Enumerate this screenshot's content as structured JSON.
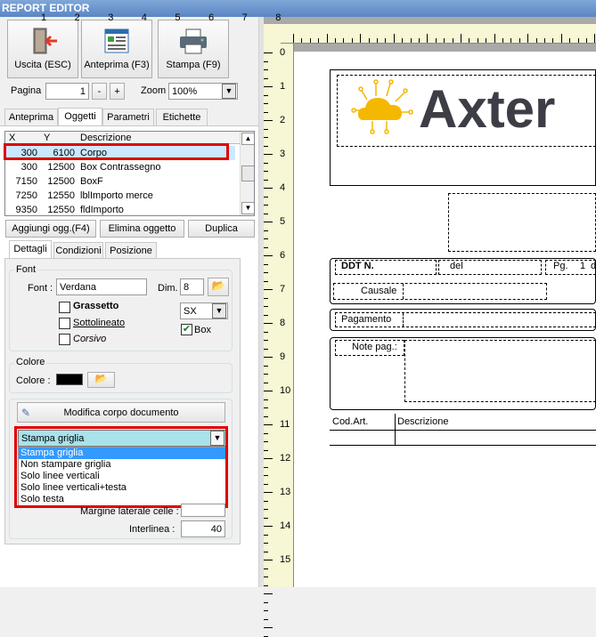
{
  "title": "REPORT EDITOR",
  "toolbar": {
    "exit": "Uscita (ESC)",
    "preview": "Anteprima (F3)",
    "print": "Stampa (F9)"
  },
  "page": {
    "label": "Pagina",
    "value": "1",
    "minus": "-",
    "plus": "+",
    "zoom_label": "Zoom",
    "zoom_value": "100%"
  },
  "main_tabs": [
    "Anteprima",
    "Oggetti",
    "Parametri",
    "Etichette"
  ],
  "grid": {
    "headers": [
      "X",
      "Y",
      "Descrizione"
    ],
    "rows": [
      [
        "300",
        "6100",
        "Corpo"
      ],
      [
        "300",
        "12500",
        "Box Contrassegno"
      ],
      [
        "7150",
        "12500",
        "BoxF"
      ],
      [
        "7250",
        "12550",
        "lblImporto merce"
      ],
      [
        "9350",
        "12550",
        "fldImporto"
      ]
    ]
  },
  "actions": {
    "add": "Aggiungi ogg.(F4)",
    "delete": "Elimina oggetto",
    "duplicate": "Duplica"
  },
  "sub_tabs": [
    "Dettagli",
    "Condizioni",
    "Posizione"
  ],
  "font": {
    "group": "Font",
    "label": "Font :",
    "value": "Verdana",
    "dim_label": "Dim.",
    "dim_value": "8",
    "bold": "Grassetto",
    "underline": "Sottolineato",
    "italic": "Corsivo",
    "align_value": "SX",
    "box": "Box"
  },
  "color": {
    "group": "Colore",
    "label": "Colore :",
    "value": "#000000"
  },
  "body": {
    "edit_button": "Modifica corpo documento",
    "grid_select": "Stampa griglia",
    "options": [
      "Stampa griglia",
      "Non stampare griglia",
      "Solo linee verticali",
      "Solo linee verticali+testa",
      "Solo testa"
    ],
    "margin_label": "Margine laterale celle :",
    "interline_label": "Interlinea :",
    "interline_value": "40"
  },
  "ruler": {
    "h": [
      "1",
      "2",
      "3",
      "4",
      "5",
      "6",
      "7",
      "8"
    ],
    "v": [
      "0",
      "1",
      "2",
      "3",
      "4",
      "5",
      "6",
      "7",
      "8",
      "9",
      "10",
      "11",
      "12",
      "13",
      "14",
      "15"
    ]
  },
  "report": {
    "logo_text": "Axter",
    "ddt": "DDT N.",
    "del": "del",
    "pg": "Pg.",
    "pg_value": "1",
    "pg_tail": "d",
    "causale": "Causale",
    "pagamento": "Pagamento",
    "note": "Note pag.:",
    "cod_art": "Cod.Art.",
    "descrizione": "Descrizione"
  },
  "colors": {
    "accent": "#e00000",
    "selection": "#cce8ff",
    "dropdown": "#a8e2ea",
    "title_bar": "#5b86c4",
    "logo_cloud": "#f5b800",
    "logo_text": "#3d3d46"
  }
}
